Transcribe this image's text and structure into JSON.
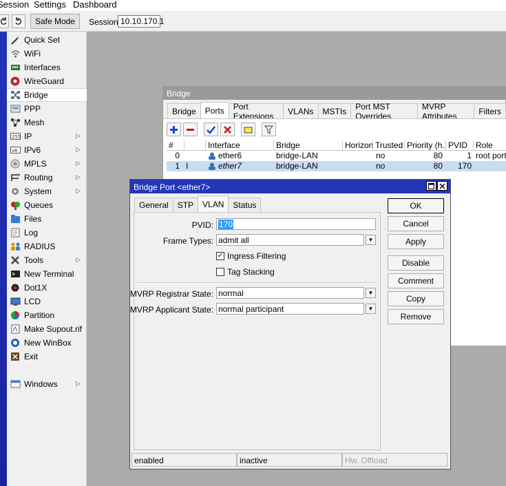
{
  "menu": {
    "session": "Session",
    "settings": "Settings",
    "dashboard": "Dashboard"
  },
  "toolbar": {
    "safe_mode": "Safe Mode",
    "session_label": "Session:",
    "session_value": "10.10.170.1"
  },
  "sidebar": {
    "items": [
      {
        "label": "Quick Set",
        "icon": "wand-icon"
      },
      {
        "label": "WiFi",
        "icon": "wifi-icon"
      },
      {
        "label": "Interfaces",
        "icon": "interfaces-icon"
      },
      {
        "label": "WireGuard",
        "icon": "wireguard-icon"
      },
      {
        "label": "Bridge",
        "icon": "bridge-icon"
      },
      {
        "label": "PPP",
        "icon": "ppp-icon"
      },
      {
        "label": "Mesh",
        "icon": "mesh-icon"
      },
      {
        "label": "IP",
        "icon": "ip-icon"
      },
      {
        "label": "IPv6",
        "icon": "ipv6-icon"
      },
      {
        "label": "MPLS",
        "icon": "mpls-icon"
      },
      {
        "label": "Routing",
        "icon": "routing-icon"
      },
      {
        "label": "System",
        "icon": "system-icon"
      },
      {
        "label": "Queues",
        "icon": "queues-icon"
      },
      {
        "label": "Files",
        "icon": "files-icon"
      },
      {
        "label": "Log",
        "icon": "log-icon"
      },
      {
        "label": "RADIUS",
        "icon": "radius-icon"
      },
      {
        "label": "Tools",
        "icon": "tools-icon"
      },
      {
        "label": "New Terminal",
        "icon": "terminal-icon"
      },
      {
        "label": "Dot1X",
        "icon": "dot1x-icon"
      },
      {
        "label": "LCD",
        "icon": "lcd-icon"
      },
      {
        "label": "Partition",
        "icon": "partition-icon"
      },
      {
        "label": "Make Supout.rif",
        "icon": "supout-icon"
      },
      {
        "label": "New WinBox",
        "icon": "winbox-icon"
      },
      {
        "label": "Exit",
        "icon": "exit-icon"
      },
      {
        "label": "Windows",
        "icon": "windows-icon"
      }
    ]
  },
  "bridge_window": {
    "title": "Bridge",
    "tabs": [
      "Bridge",
      "Ports",
      "Port Extensions",
      "VLANs",
      "MSTIs",
      "Port MST Overrides",
      "MVRP Attributes",
      "Filters"
    ],
    "columns": [
      "#",
      "",
      "Interface",
      "Bridge",
      "Horizon",
      "Trusted",
      "Priority (h...",
      "PVID",
      "Role"
    ],
    "rows": [
      {
        "num": "0",
        "flag": "",
        "interface": "ether6",
        "bridge": "bridge-LAN",
        "horizon": "",
        "trusted": "no",
        "priority": "80",
        "pvid": "1",
        "role": "root port"
      },
      {
        "num": "1",
        "flag": "I",
        "interface": "ether7",
        "bridge": "bridge-LAN",
        "horizon": "",
        "trusted": "no",
        "priority": "80",
        "pvid": "170",
        "role": ""
      }
    ]
  },
  "dialog": {
    "title": "Bridge Port <ether7>",
    "tabs": [
      "General",
      "STP",
      "VLAN",
      "Status"
    ],
    "pvid_label": "PVID:",
    "pvid_value": "170",
    "frame_types_label": "Frame Types:",
    "frame_types_value": "admit all",
    "ingress_filtering_label": "Ingress Filtering",
    "tag_stacking_label": "Tag Stacking",
    "mvrp_registrar_label": "MVRP Registrar State:",
    "mvrp_registrar_value": "normal",
    "mvrp_applicant_label": "MVRP Applicant State:",
    "mvrp_applicant_value": "normal participant",
    "buttons": {
      "ok": "OK",
      "cancel": "Cancel",
      "apply": "Apply",
      "disable": "Disable",
      "comment": "Comment",
      "copy": "Copy",
      "remove": "Remove"
    },
    "status": {
      "enabled": "enabled",
      "inactive": "inactive",
      "hw_offload": "Hw. Offload"
    }
  }
}
